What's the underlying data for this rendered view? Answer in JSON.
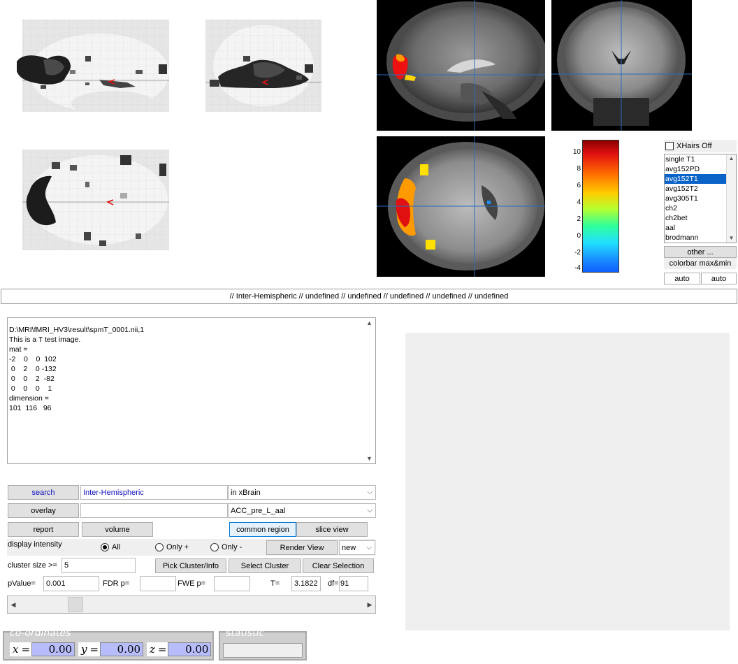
{
  "colorbar": {
    "ticks": [
      "10",
      "8",
      "6",
      "4",
      "2",
      "0",
      "-2",
      "-4"
    ]
  },
  "xhairs": {
    "label": "XHairs Off"
  },
  "templates": {
    "items": [
      "single T1",
      "avg152PD",
      "avg152T1",
      "avg152T2",
      "avg305T1",
      "ch2",
      "ch2bet",
      "aal",
      "brodmann"
    ],
    "selected": "avg152T1"
  },
  "other_button": "other ...",
  "colorbar_label": "colorbar max&min",
  "auto_left": "auto",
  "auto_right": "auto",
  "label_strip": "// Inter-Hemispheric // undefined // undefined // undefined // undefined // undefined",
  "info_lines": [
    "D:\\MRI\\fMRI_HV3\\result\\spmT_0001.nii,1",
    "This is a T test image.",
    "mat =",
    "-2    0    0  102",
    " 0    2    0 -132",
    " 0    0    2  -82",
    " 0    0    0    1",
    "dimension =",
    "101  116   96"
  ],
  "controls": {
    "search_button": "search",
    "search_value": "Inter-Hemispheric",
    "search_scope": "in xBrain",
    "overlay_button": "overlay",
    "overlay_value": "",
    "overlay_region": "ACC_pre_L_aal",
    "report_button": "report",
    "volume_button": "volume",
    "common_region_button": "common region",
    "slice_view_button": "slice view",
    "display_intensity_label": "display intensity",
    "radio_all": "All",
    "radio_only_pos": "Only +",
    "radio_only_neg": "Only -",
    "render_view_button": "Render View",
    "render_mode": "new",
    "cluster_size_label": "cluster size >=",
    "cluster_size_value": "5",
    "pick_cluster_button": "Pick Cluster/Info",
    "select_cluster_button": "Select Cluster",
    "clear_selection_button": "Clear Selection",
    "pvalue_label": "pValue=",
    "pvalue_value": "0.001",
    "fdr_label": "FDR p=",
    "fdr_value": "",
    "fwe_label": "FWE p=",
    "fwe_value": "",
    "t_label": "T=",
    "t_value": "3.1822",
    "df_label": "df=",
    "df_value": "91"
  },
  "coordinates": {
    "title": "co-ordinates",
    "x_label": "x",
    "x_value": "0.00",
    "y_label": "y",
    "y_value": "0.00",
    "z_label": "z",
    "z_value": "0.00"
  },
  "statistic": {
    "title": "statistic",
    "value": ""
  }
}
